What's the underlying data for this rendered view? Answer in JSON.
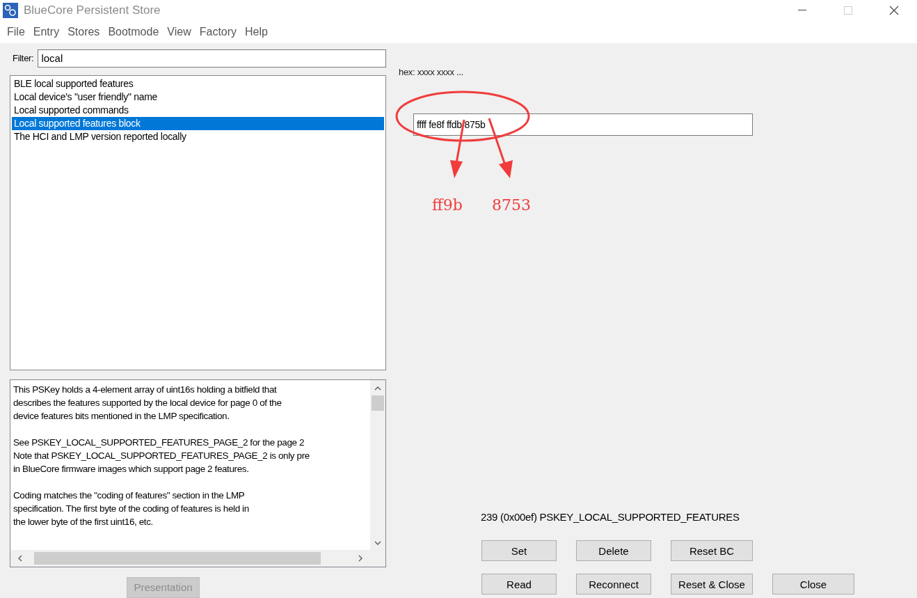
{
  "window": {
    "title": "BlueCore Persistent Store"
  },
  "menu": [
    "File",
    "Entry",
    "Stores",
    "Bootmode",
    "View",
    "Factory",
    "Help"
  ],
  "filter": {
    "label": "Filter:",
    "value": "local"
  },
  "keys": [
    {
      "label": "BLE local supported features",
      "selected": false
    },
    {
      "label": "Local device's \"user friendly\" name",
      "selected": false
    },
    {
      "label": "Local supported commands",
      "selected": false
    },
    {
      "label": "Local supported features block",
      "selected": true
    },
    {
      "label": "The HCI and LMP version reported locally",
      "selected": false
    }
  ],
  "description": [
    [
      "This PSKey holds a 4-element array of uint16s holding a bitfield that",
      "describes the features supported by the local device for page 0 of the",
      "device features bits mentioned in the LMP specification."
    ],
    [
      "See PSKEY_LOCAL_SUPPORTED_FEATURES_PAGE_2 for the page 2",
      "Note that PSKEY_LOCAL_SUPPORTED_FEATURES_PAGE_2 is only pre",
      "in BlueCore firmware images which support page 2 features."
    ],
    [
      "Coding matches the \"coding of features\" section in the LMP",
      "specification. The first byte of the coding of features is held in",
      "the lower byte of the first uint16, etc."
    ]
  ],
  "presentation_button": {
    "label": "Presentation",
    "disabled": true
  },
  "format_hint": "hex: xxxx xxxx ...",
  "value_field": {
    "value": "ffff fe8f ffdb 875b"
  },
  "annotations": [
    "ff9b",
    "8753"
  ],
  "key_info": "239 (0x00ef) PSKEY_LOCAL_SUPPORTED_FEATURES",
  "buttons": [
    [
      "Set",
      "Delete",
      "Reset BC"
    ],
    [
      "Read",
      "Reconnect",
      "Reset & Close",
      "Close"
    ]
  ]
}
